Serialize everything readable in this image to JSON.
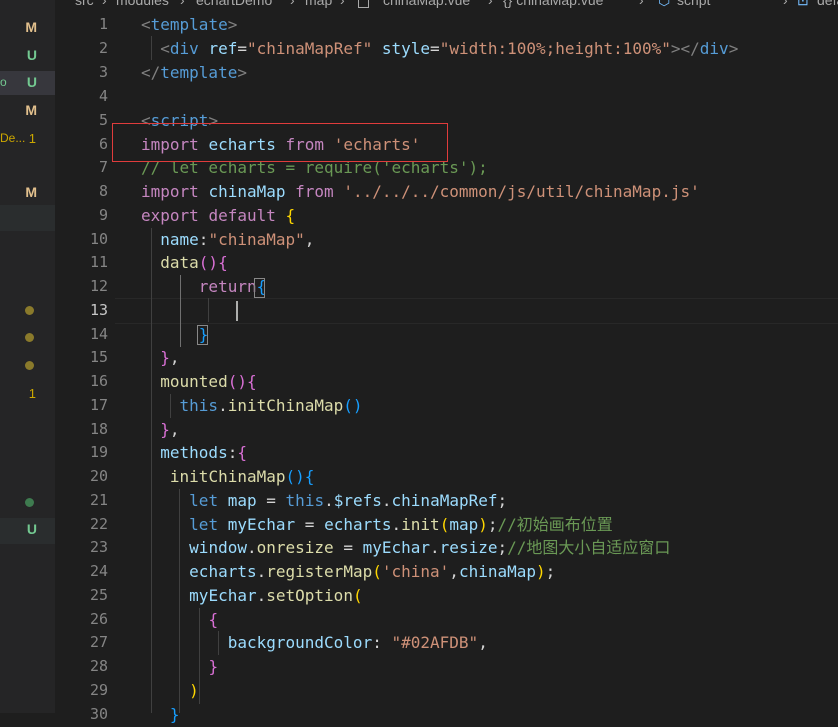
{
  "breadcrumb": {
    "src": "src",
    "modules": "modules",
    "folder": "echartDemo",
    "sub": "map",
    "file": "chinaMap.vue",
    "symbol": "{} chinaMap.vue",
    "section": "script",
    "export": "default"
  },
  "sidebar": {
    "rows": [
      {
        "letter": "M",
        "color": "#e2c08d"
      },
      {
        "letter": "U",
        "color": "#73c991"
      },
      {
        "frag": "o",
        "letter": "U",
        "color": "#73c991"
      },
      {
        "letter": "M",
        "color": "#e2c08d"
      },
      {
        "frag": "De...",
        "letter": "1",
        "color": "#cca700"
      },
      {
        "letter": "M",
        "color": "#e2c08d"
      },
      {
        "dot": "#8a7a2b"
      },
      {
        "dot": "#8a7a2b"
      },
      {
        "dot": "#8a7a2b"
      },
      {
        "num": "1",
        "color": "#cca700"
      },
      {
        "dot": "#3e7b4f"
      },
      {
        "letter": "U",
        "color": "#73c991"
      }
    ]
  },
  "editor": {
    "line_numbers": [
      "1",
      "2",
      "3",
      "4",
      "5",
      "6",
      "7",
      "8",
      "9",
      "10",
      "11",
      "12",
      "13",
      "14",
      "15",
      "16",
      "17",
      "18",
      "19",
      "20",
      "21",
      "22",
      "23",
      "24",
      "25",
      "26",
      "27",
      "28",
      "29",
      "30"
    ],
    "tokens": {
      "template": "template",
      "div": "div",
      "ref": "ref",
      "ref_val": "\"chinaMapRef\"",
      "style": "style",
      "style_val": "\"width:100%;height:100%\"",
      "script": "script",
      "import": "import",
      "echarts": "echarts",
      "from": "from",
      "echarts_str": "'echarts'",
      "comment_require": "// let echarts = require('echarts');",
      "chinaMap": "chinaMap",
      "chinaMap_path": "'../../../common/js/util/chinaMap.js'",
      "export": "export",
      "default": "default",
      "name": "name",
      "name_val": "\"chinaMap\"",
      "data": "data",
      "return": "return",
      "mounted": "mounted",
      "this": "this",
      "initChinaMap": "initChinaMap",
      "methods": "methods",
      "let": "let",
      "map": "map",
      "refs": "$refs",
      "chinaMapRef": "chinaMapRef",
      "myEchar": "myEchar",
      "init": "init",
      "comment_init": "//初始画布位置",
      "window": "window",
      "onresize": "onresize",
      "resize": "resize",
      "comment_resize": "//地图大小自适应窗口",
      "registerMap": "registerMap",
      "china_str": "'china'",
      "setOption": "setOption",
      "backgroundColor": "backgroundColor",
      "bg_val": "\"#02AFDB\""
    }
  }
}
